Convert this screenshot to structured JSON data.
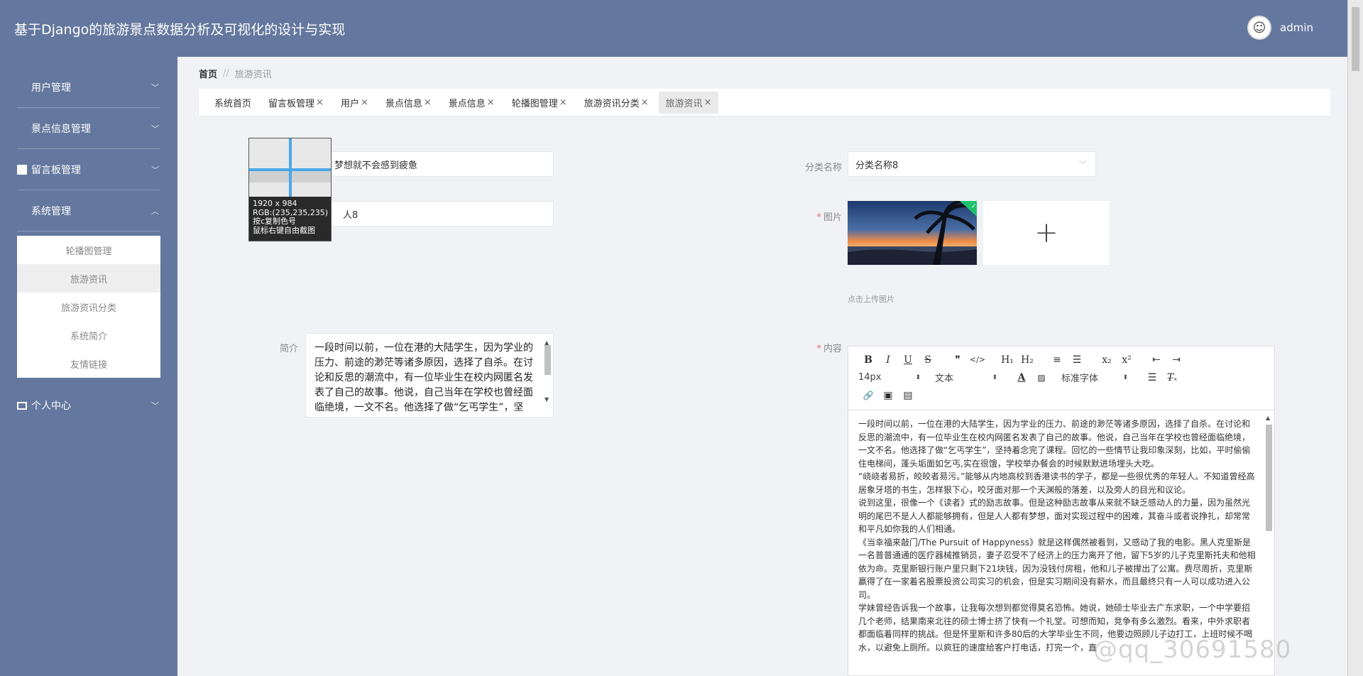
{
  "header": {
    "title": "基于Django的旅游景点数据分析及可视化的设计与实现",
    "username": "admin"
  },
  "sidebar": {
    "items": [
      {
        "label": "用户管理",
        "icon": "grid-icon",
        "chevron": "chevron-down-icon"
      },
      {
        "label": "景点信息管理",
        "icon": "grid-icon",
        "chevron": "chevron-down-icon"
      },
      {
        "label": "留言板管理",
        "icon": "clipboard-icon",
        "chevron": "chevron-down-icon"
      },
      {
        "label": "系统管理",
        "icon": "grid-icon",
        "chevron": "chevron-up-icon"
      },
      {
        "label": "个人中心",
        "icon": "card-icon",
        "chevron": "chevron-down-icon"
      }
    ],
    "submenu": [
      "轮播图管理",
      "旅游资讯",
      "旅游资讯分类",
      "系统简介",
      "友情链接"
    ]
  },
  "breadcrumb": {
    "home": "首页",
    "separator": "//",
    "current": "旅游资讯"
  },
  "tabs": [
    "系统首页",
    "留言板管理",
    "用户",
    "景点信息",
    "景点信息",
    "轮播图管理",
    "旅游资讯分类",
    "旅游资讯"
  ],
  "form": {
    "title_value": "梦想就不会感到疲惫",
    "author_value": "人8",
    "category_label": "分类名称",
    "category_value": "分类名称8",
    "image_label": "图片",
    "upload_hint": "点击上传图片",
    "summary_label": "简介",
    "summary_text": "一段时间以前，一位在港的大陆学生，因为学业的压力、前途的渺茫等诸多原因，选择了自杀。在讨论和反思的潮流中，有一位毕业生在校内网匿名发表了自己的故事。他说，自己当年在学校也曾经面临绝境，一文不名。他选择了做“乞丐学生”，坚",
    "content_label": "内容"
  },
  "editor": {
    "toolbar_row1": [
      "B",
      "I",
      "U",
      "S",
      "❞",
      "</>",
      "H₁",
      "H₂",
      "≡",
      "☰",
      "x₂",
      "x²",
      "⇤",
      "⇥"
    ],
    "font_size": "14px",
    "text_type": "文本",
    "font_family": "标准字体",
    "toolbar_row3": [
      "🔗",
      "▣",
      "▤"
    ],
    "paragraphs": [
      "一段时间以前，一位在港的大陆学生，因为学业的压力、前途的渺茫等诸多原因，选择了自杀。在讨论和反思的潮流中，有一位毕业生在校内网匿名发表了自己的故事。他说，自己当年在学校也曾经面临绝境，一文不名。他选择了做“乞丐学生”，坚持着念完了课程。回忆的一些情节让我印象深刻，比如，平时偷偷住电梯间，蓬头垢面如乞丐,实在很饿，学校举办餐会的时候默默进场埋头大吃。",
      "“峣峣者易折，皎皎者易污。”能够从内地高校到香港读书的学子，都是一些很优秀的年轻人。不知道曾经高居象牙塔的书生，怎样狠下心，咬牙面对那一个天渊般的落差，以及旁人的目光和议论。",
      "说到这里，很像一个《读者》式的励志故事。但是这种励志故事从来就不缺乏感动人的力量，因为虽然光明的尾巴不是人人都能够拥有，但是人人都有梦想，面对实现过程中的困难，其奋斗或者说挣扎，却常常和平凡如你我的人们相通。",
      "《当幸福来敲门/The Pursuit of Happyness》就是这样偶然被看到，又感动了我的电影。黑人克里斯是一名普普通通的医疗器械推销员，妻子忍受不了经济上的压力离开了他，留下5岁的儿子克里斯托夫和他相依为命。克里斯银行账户里只剩下21块钱，因为没钱付房租，他和儿子被撵出了公寓。费尽周折，克里斯赢得了在一家着名股票投资公司实习的机会，但是实习期间没有薪水，而且最终只有一人可以成功进入公司。",
      "学妹曾经告诉我一个故事，让我每次想到都觉得莫名恐怖。她说，她硕士毕业去广东求职，一个中学要招几个老师，结果南来北往的硕士博士挤了快有一个礼堂。可想而知，竞争有多么激烈。看来，中外求职者都面临着同样的挑战。但是怀里斯和许多80后的大学毕业生不同，他要边照顾儿子边打工，上班时候不喝水，以避免上厕所。以疯狂的速度给客户打电话，打完一个，直"
    ]
  },
  "overlay": {
    "dimensions": "1920 x 984",
    "rgb": "RGB:(235,235,235)",
    "hint1": "按c复制色号",
    "hint2": "鼠标右键自由截图"
  },
  "watermark": "@qq_30691580",
  "colors": {
    "header_bg": "#64779e",
    "sidebar_bg": "#64779e",
    "required": "#f56c6c",
    "crosshair": "#4aa8e8"
  }
}
